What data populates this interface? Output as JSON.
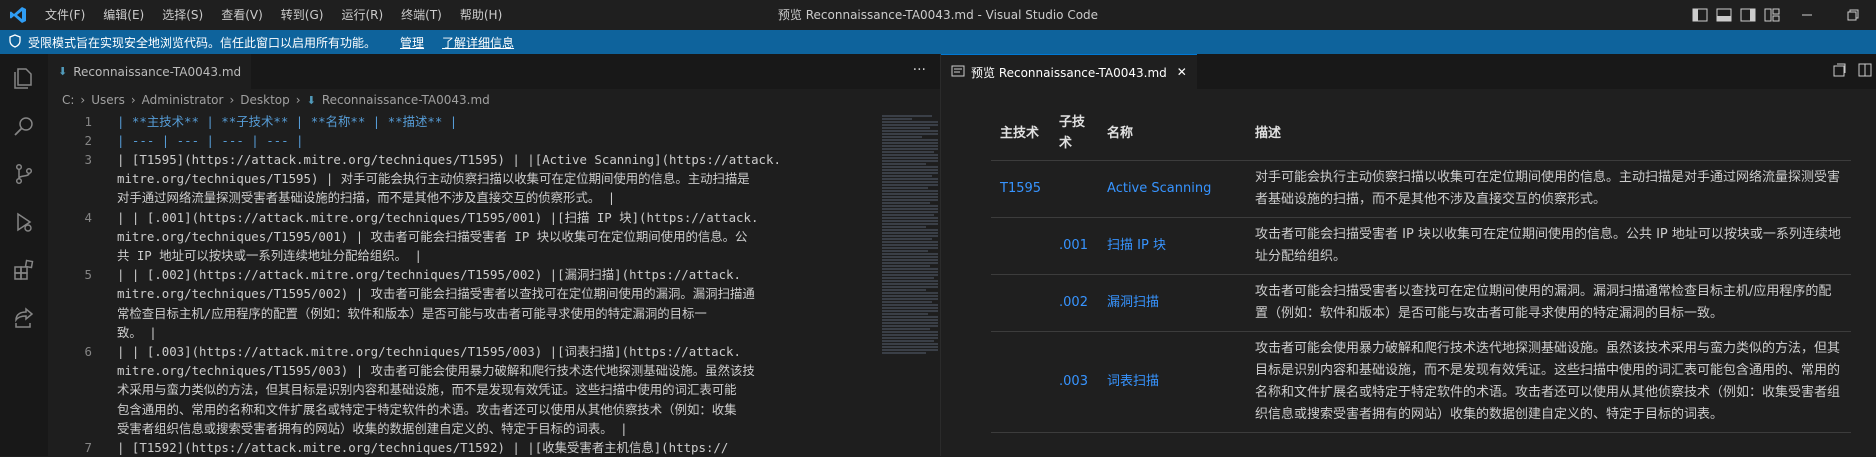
{
  "titlebar": {
    "menu": [
      "文件(F)",
      "编辑(E)",
      "选择(S)",
      "查看(V)",
      "转到(G)",
      "运行(R)",
      "终端(T)",
      "帮助(H)"
    ],
    "window_title": "预览 Reconnaissance-TA0043.md - Visual Studio Code"
  },
  "banner": {
    "text": "受限模式旨在实现安全地浏览代码。信任此窗口以启用所有功能。",
    "manage_link": "管理",
    "learn_more_link": "了解详细信息"
  },
  "editor": {
    "tab_label": "Reconnaissance-TA0043.md",
    "more_actions": "···",
    "breadcrumb": [
      "C:",
      "Users",
      "Administrator",
      "Desktop",
      "Reconnaissance-TA0043.md"
    ],
    "line_numbers": [
      "1",
      "2",
      "3",
      "4",
      "5",
      "6",
      "7"
    ],
    "code_lines": [
      "| **主技术** | **子技术** | **名称** | **描述** |",
      "| --- | --- | --- | --- |",
      "| [T1595](https://attack.mitre.org/techniques/T1595) |  |[Active Scanning](https://attack.",
      "mitre.org/techniques/T1595) | 对手可能会执行主动侦察扫描以收集可在定位期间使用的信息。主动扫描是",
      "对手通过网络流量探测受害者基础设施的扫描，而不是其他不涉及直接交互的侦察形式。 |",
      "|  | [.001](https://attack.mitre.org/techniques/T1595/001) |[扫描 IP 块](https://attack.",
      "mitre.org/techniques/T1595/001) | 攻击者可能会扫描受害者 IP 块以收集可在定位期间使用的信息。公",
      "共 IP 地址可以按块或一系列连续地址分配给组织。 |",
      "|  | [.002](https://attack.mitre.org/techniques/T1595/002) |[漏洞扫描](https://attack.",
      "mitre.org/techniques/T1595/002) | 攻击者可能会扫描受害者以查找可在定位期间使用的漏洞。漏洞扫描通",
      "常检查目标主机/应用程序的配置（例如：软件和版本）是否可能与攻击者可能寻求使用的特定漏洞的目标一",
      "致。 |",
      "|  | [.003](https://attack.mitre.org/techniques/T1595/003) |[词表扫描](https://attack.",
      "mitre.org/techniques/T1595/003) | 攻击者可能会使用暴力破解和爬行技术迭代地探测基础设施。虽然该技",
      "术采用与蛮力类似的方法，但其目标是识别内容和基础设施，而不是发现有效凭证。这些扫描中使用的词汇表可能",
      "包含通用的、常用的名称和文件扩展名或特定于特定软件的术语。攻击者还可以使用从其他侦察技术（例如：收集",
      "受害者组织信息或搜索受害者拥有的网站）收集的数据创建自定义的、特定于目标的词表。 |",
      "| [T1592](https://attack.mitre.org/techniques/T1592) |  |[收集受害者主机信息](https://"
    ]
  },
  "preview": {
    "tab_label": "预览 Reconnaissance-TA0043.md",
    "headers": [
      "主技术",
      "子技术",
      "名称",
      "描述"
    ],
    "rows": [
      {
        "main": "T1595",
        "sub": "",
        "name": "Active Scanning",
        "desc": "对手可能会执行主动侦察扫描以收集可在定位期间使用的信息。主动扫描是对手通过网络流量探测受害者基础设施的扫描，而不是其他不涉及直接交互的侦察形式。"
      },
      {
        "main": "",
        "sub": ".001",
        "name": "扫描 IP 块",
        "desc": "攻击者可能会扫描受害者 IP 块以收集可在定位期间使用的信息。公共 IP 地址可以按块或一系列连续地址分配给组织。"
      },
      {
        "main": "",
        "sub": ".002",
        "name": "漏洞扫描",
        "desc": "攻击者可能会扫描受害者以查找可在定位期间使用的漏洞。漏洞扫描通常检查目标主机/应用程序的配置（例如：软件和版本）是否可能与攻击者可能寻求使用的特定漏洞的目标一致。"
      },
      {
        "main": "",
        "sub": ".003",
        "name": "词表扫描",
        "desc": "攻击者可能会使用暴力破解和爬行技术迭代地探测基础设施。虽然该技术采用与蛮力类似的方法，但其目标是识别内容和基础设施，而不是发现有效凭证。这些扫描中使用的词汇表可能包含通用的、常用的名称和文件扩展名或特定于特定软件的术语。攻击者还可以使用从其他侦察技术（例如：收集受害者组织信息或搜索受害者拥有的网站）收集的数据创建自定义的、特定于目标的词表。"
      }
    ]
  },
  "colors": {
    "accent": "#0078d4",
    "banner": "#0e639c",
    "link": "#3794ff",
    "md_bold": "#569cd6",
    "md_link_text": "#ce9178"
  },
  "icons": [
    "vscode-logo-icon",
    "explorer-icon",
    "search-icon",
    "source-control-icon",
    "run-debug-icon",
    "extensions-icon",
    "remote-icon",
    "shield-icon",
    "markdown-file-icon",
    "preview-icon",
    "close-icon",
    "split-editor-icon",
    "more-icon",
    "minimize-icon",
    "maximize-icon",
    "window-close-icon"
  ]
}
